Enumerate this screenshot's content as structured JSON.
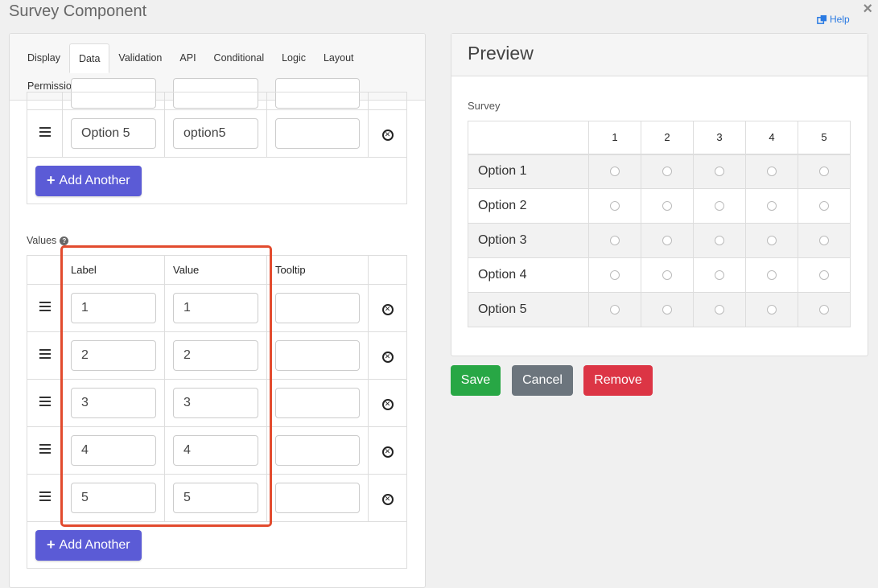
{
  "window": {
    "title": "Survey Component",
    "close": "×",
    "help": "Help"
  },
  "tabs": {
    "row1": [
      "Display",
      "Data",
      "Validation",
      "API",
      "Conditional",
      "Logic",
      "Layout"
    ],
    "row2": [
      "Permissions"
    ],
    "active": "Data"
  },
  "questions_table": {
    "partial_row": {
      "label": "",
      "value": "",
      "tooltip": ""
    },
    "rows": [
      {
        "label": "Option 5",
        "value": "option5",
        "tooltip": ""
      }
    ],
    "add_label": "Add Another"
  },
  "values_section": {
    "label": "Values",
    "headers": {
      "label": "Label",
      "value": "Value",
      "tooltip": "Tooltip"
    },
    "rows": [
      {
        "label": "1",
        "value": "1",
        "tooltip": ""
      },
      {
        "label": "2",
        "value": "2",
        "tooltip": ""
      },
      {
        "label": "3",
        "value": "3",
        "tooltip": ""
      },
      {
        "label": "4",
        "value": "4",
        "tooltip": ""
      },
      {
        "label": "5",
        "value": "5",
        "tooltip": ""
      }
    ],
    "add_label": "Add Another"
  },
  "preview": {
    "title": "Preview",
    "survey_label": "Survey",
    "columns": [
      "1",
      "2",
      "3",
      "4",
      "5"
    ],
    "rows": [
      "Option 1",
      "Option 2",
      "Option 3",
      "Option 4",
      "Option 5"
    ]
  },
  "actions": {
    "save": "Save",
    "cancel": "Cancel",
    "remove": "Remove"
  },
  "colors": {
    "save": "#28a745",
    "cancel": "#6c757d",
    "remove": "#dc3545",
    "add_button": "#5b5bd6",
    "highlight": "#e24b2e",
    "help_link": "#2a7ae2"
  }
}
